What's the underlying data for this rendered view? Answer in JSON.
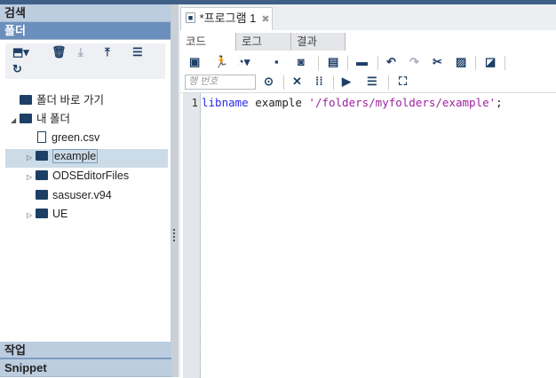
{
  "left": {
    "search_label": "검색",
    "folders_label": "폴더",
    "tree": {
      "shortcut": "폴더 바로 가기",
      "my_folder": "내 폴더",
      "items": [
        "green.csv",
        "example",
        "ODSEditorFiles",
        "sasuser.v94",
        "UE"
      ]
    },
    "tasks_label": "작업",
    "snippets_label": "Snippet"
  },
  "editor": {
    "tab_title": "*프로그램 1",
    "subtabs": [
      "코드",
      "로그",
      "결과"
    ],
    "line_input_placeholder": "행 번호",
    "line_number": "1",
    "code": {
      "keyword": "libname",
      "middle": " example ",
      "string": "'/folders/myfolders/example'",
      "end": ";"
    }
  }
}
